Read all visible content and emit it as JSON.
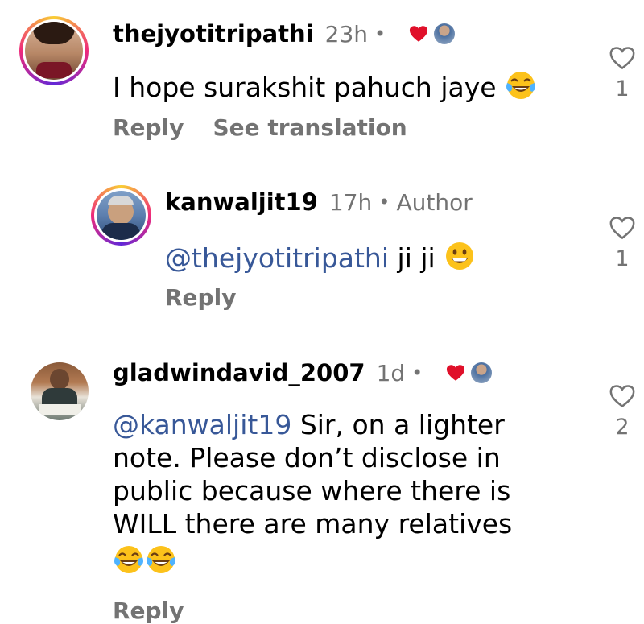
{
  "comments": [
    {
      "username": "thejyotitripathi",
      "time": "23h",
      "dot": "•",
      "text": "I hope surakshit  pahuch jaye",
      "emoji_icons": [
        "face-with-tears-of-joy-icon"
      ],
      "actions": [
        "Reply",
        "See translation"
      ],
      "like_count": "1"
    },
    {
      "username": "kanwaljit19",
      "time": "17h",
      "dot": "•",
      "author_label": "Author",
      "mention": "@thejyotitripathi",
      "text": " ji ji",
      "emoji_icons": [
        "grinning-face-icon"
      ],
      "actions": [
        "Reply"
      ],
      "like_count": "1"
    },
    {
      "username": "gladwindavid_2007",
      "time": "1d",
      "dot": "•",
      "mention": "@kanwaljit19",
      "text_line1": " Sir, on a lighter",
      "text_line2": "note. Please don’t disclose in",
      "text_line3": "public because where there is",
      "text_line4": "WILL there are many relatives",
      "emoji_icons": [
        "face-with-tears-of-joy-icon",
        "face-with-tears-of-joy-icon"
      ],
      "actions": [
        "Reply"
      ],
      "like_count": "2"
    }
  ],
  "colors": {
    "secondary_text": "#737373",
    "mention": "#385898",
    "heart_liked": "#e0102a",
    "emoji_yellow": "#fcc21b"
  }
}
